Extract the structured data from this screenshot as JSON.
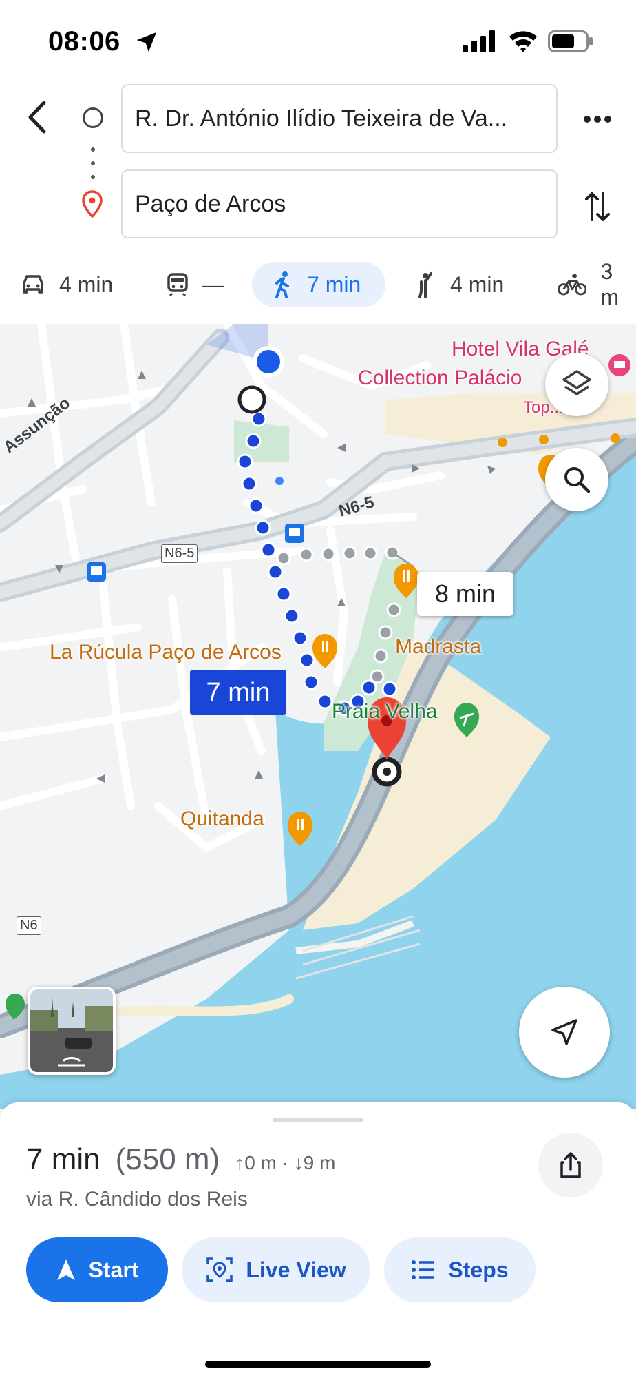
{
  "status_bar": {
    "time": "08:06",
    "icons": [
      "location-arrow-icon",
      "signal-icon",
      "wifi-icon",
      "battery-icon"
    ]
  },
  "directions": {
    "origin": "R. Dr. António Ilídio Teixeira de Va...",
    "destination": "Paço de Arcos",
    "icons": [
      "back-arrow-icon",
      "origin-circle-icon",
      "destination-pin-icon",
      "more-icon",
      "swap-icon"
    ]
  },
  "travel_modes": [
    {
      "mode": "car",
      "icon": "car-icon",
      "label": "4 min"
    },
    {
      "mode": "transit",
      "icon": "train-icon",
      "label": "—"
    },
    {
      "mode": "walk",
      "icon": "walking-icon",
      "label": "7 min",
      "selected": true
    },
    {
      "mode": "ride",
      "icon": "hailing-icon",
      "label": "4 min"
    },
    {
      "mode": "bike",
      "icon": "bicycle-icon",
      "label": "3 m"
    }
  ],
  "map": {
    "pois": {
      "hotel_line1": "Hotel Vila Galé",
      "hotel_line2": "Collection Palácio",
      "top_partial": "Top...",
      "rucula": "La Rúcula Paço de Arcos",
      "madrasta": "Madrasta",
      "praia": "Praia Velha",
      "quitanda": "Quitanda"
    },
    "roads": {
      "assuncao": "Assunção",
      "n6_5_a": "N6-5",
      "n6_5_b": "N6-5",
      "n6": "N6"
    },
    "route_labels": {
      "main": "7 min",
      "alternative": "8 min"
    },
    "colors": {
      "route": "#1a46d8",
      "alt_route": "#9aa0a6",
      "water": "#8fd3ec",
      "sand": "#f6edd6",
      "park": "#cde9d6",
      "highway": "#9aaab8",
      "pin": "#ea4335"
    }
  },
  "summary": {
    "time": "7 min",
    "distance": "(550 m)",
    "elevation": "↑0 m · ↓9 m",
    "via": "via R. Cândido dos Reis"
  },
  "actions": {
    "start": "Start",
    "live_view": "Live View",
    "steps": "Steps"
  }
}
